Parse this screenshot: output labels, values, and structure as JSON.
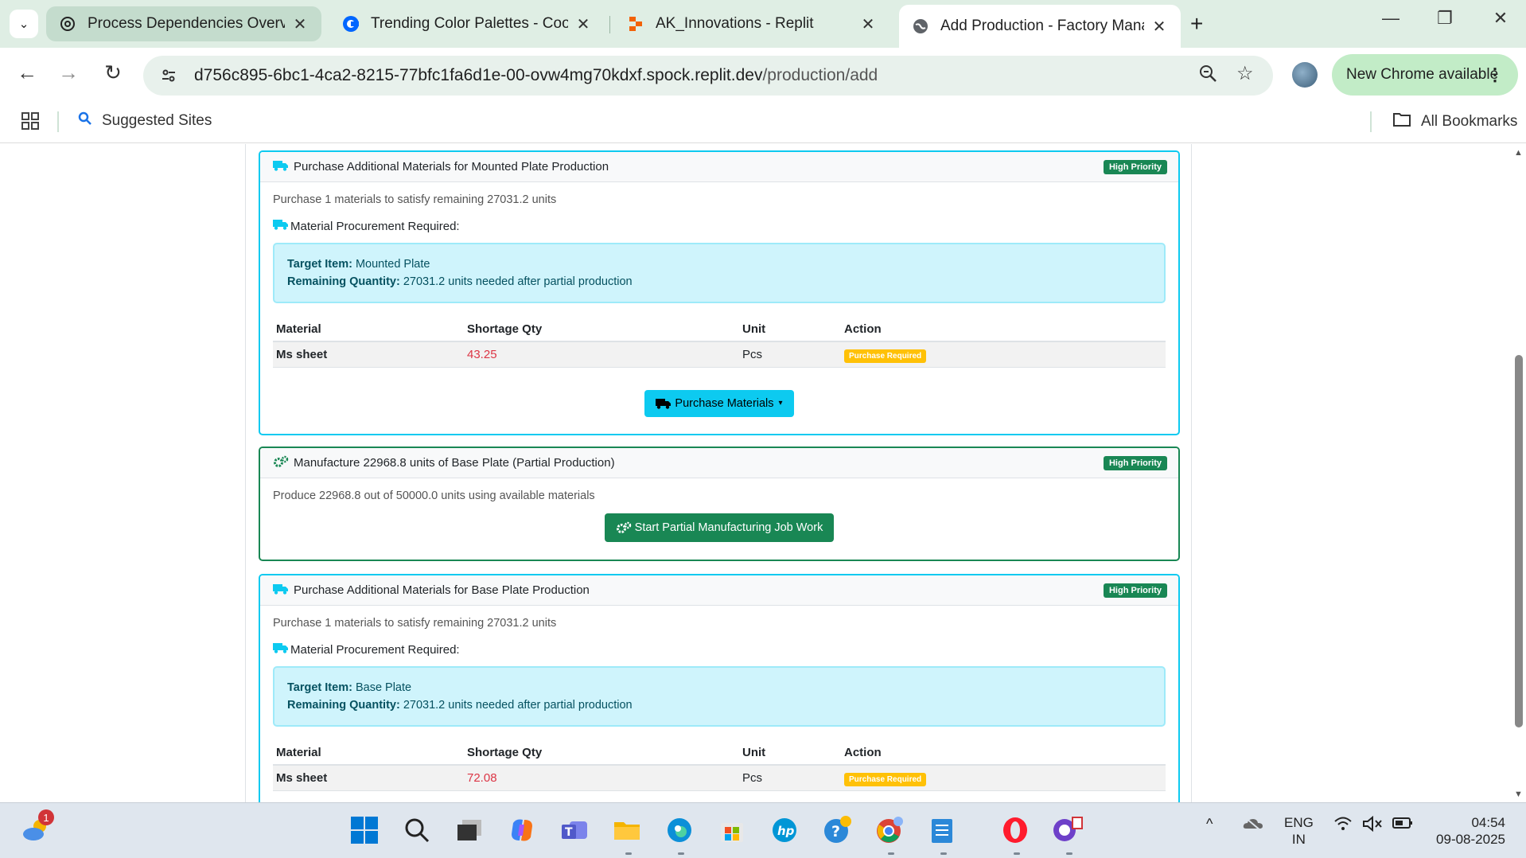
{
  "browser": {
    "tabs": [
      {
        "title": "Process Dependencies Overview"
      },
      {
        "title": "Trending Color Palettes - Coolors"
      },
      {
        "title": "AK_Innovations - Replit"
      },
      {
        "title": "Add Production - Factory Management"
      }
    ],
    "url_host": "d756c895-6bc1-4ca2-8215-77bfc1fa6d1e-00-ovw4mg70kdxf.spock.replit.dev",
    "url_path": "/production/add",
    "update_label": "New Chrome available",
    "bookmarks": {
      "suggested": "Suggested Sites",
      "all": "All Bookmarks"
    }
  },
  "cards": [
    {
      "title": "Purchase Additional Materials for Mounted Plate Production",
      "priority": "High Priority",
      "description": "Purchase 1 materials to satisfy remaining 27031.2 units",
      "procurement_title": "Material Procurement Required:",
      "target_label": "Target Item:",
      "target_value": "Mounted Plate",
      "remaining_label": "Remaining Quantity:",
      "remaining_value": "27031.2 units needed after partial production",
      "columns": [
        "Material",
        "Shortage Qty",
        "Unit",
        "Action"
      ],
      "row": {
        "material": "Ms sheet",
        "shortage": "43.25",
        "unit": "Pcs",
        "action": "Purchase Required"
      },
      "button": "Purchase Materials"
    },
    {
      "title": "Manufacture 22968.8 units of Base Plate (Partial Production)",
      "priority": "High Priority",
      "description": "Produce 22968.8 out of 50000.0 units using available materials",
      "button": "Start Partial Manufacturing Job Work"
    },
    {
      "title": "Purchase Additional Materials for Base Plate Production",
      "priority": "High Priority",
      "description": "Purchase 1 materials to satisfy remaining 27031.2 units",
      "procurement_title": "Material Procurement Required:",
      "target_label": "Target Item:",
      "target_value": "Base Plate",
      "remaining_label": "Remaining Quantity:",
      "remaining_value": "27031.2 units needed after partial production",
      "columns": [
        "Material",
        "Shortage Qty",
        "Unit",
        "Action"
      ],
      "row": {
        "material": "Ms sheet",
        "shortage": "72.08",
        "unit": "Pcs",
        "action": "Purchase Required"
      }
    }
  ],
  "taskbar": {
    "weather_badge": "1",
    "lang_top": "ENG",
    "lang_bottom": "IN",
    "time": "04:54",
    "date": "09-08-2025"
  },
  "colors": {
    "info": "#0dcaf0",
    "success": "#198754",
    "warning": "#ffc107",
    "danger": "#dc3545"
  }
}
